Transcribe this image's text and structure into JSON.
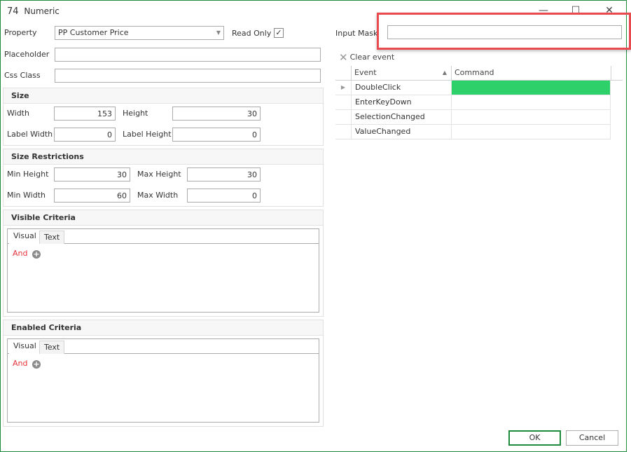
{
  "window": {
    "title_number": "74",
    "title_text": "Numeric",
    "minimize": "—",
    "maximize": "☐",
    "close": "✕"
  },
  "form": {
    "property_label": "Property",
    "property_value": "PP Customer Price",
    "read_only_label": "Read Only",
    "read_only_checked": "✓",
    "placeholder_label": "Placeholder",
    "placeholder_value": "",
    "css_class_label": "Css Class",
    "css_class_value": "",
    "input_mask_label": "Input Mask",
    "input_mask_value": ""
  },
  "size": {
    "title": "Size",
    "width_label": "Width",
    "width_value": "153",
    "height_label": "Height",
    "height_value": "30",
    "label_width_label": "Label Width",
    "label_width_value": "0",
    "label_height_label": "Label Height",
    "label_height_value": "0"
  },
  "size_restrictions": {
    "title": "Size Restrictions",
    "min_height_label": "Min Height",
    "min_height_value": "30",
    "max_height_label": "Max Height",
    "max_height_value": "30",
    "min_width_label": "Min Width",
    "min_width_value": "60",
    "max_width_label": "Max Width",
    "max_width_value": "0"
  },
  "visible_criteria": {
    "title": "Visible Criteria",
    "tabs": [
      "Visual",
      "Text"
    ],
    "operator": "And"
  },
  "enabled_criteria": {
    "title": "Enabled Criteria",
    "tabs": [
      "Visual",
      "Text"
    ],
    "operator": "And"
  },
  "events": {
    "clear_label": "Clear event",
    "columns": [
      "Event",
      "Command"
    ],
    "rows": [
      {
        "event": "DoubleClick",
        "command": "",
        "selected": true
      },
      {
        "event": "EnterKeyDown",
        "command": ""
      },
      {
        "event": "SelectionChanged",
        "command": ""
      },
      {
        "event": "ValueChanged",
        "command": ""
      }
    ],
    "selected_color": "#2ed06a"
  },
  "buttons": {
    "ok": "OK",
    "cancel": "Cancel"
  }
}
